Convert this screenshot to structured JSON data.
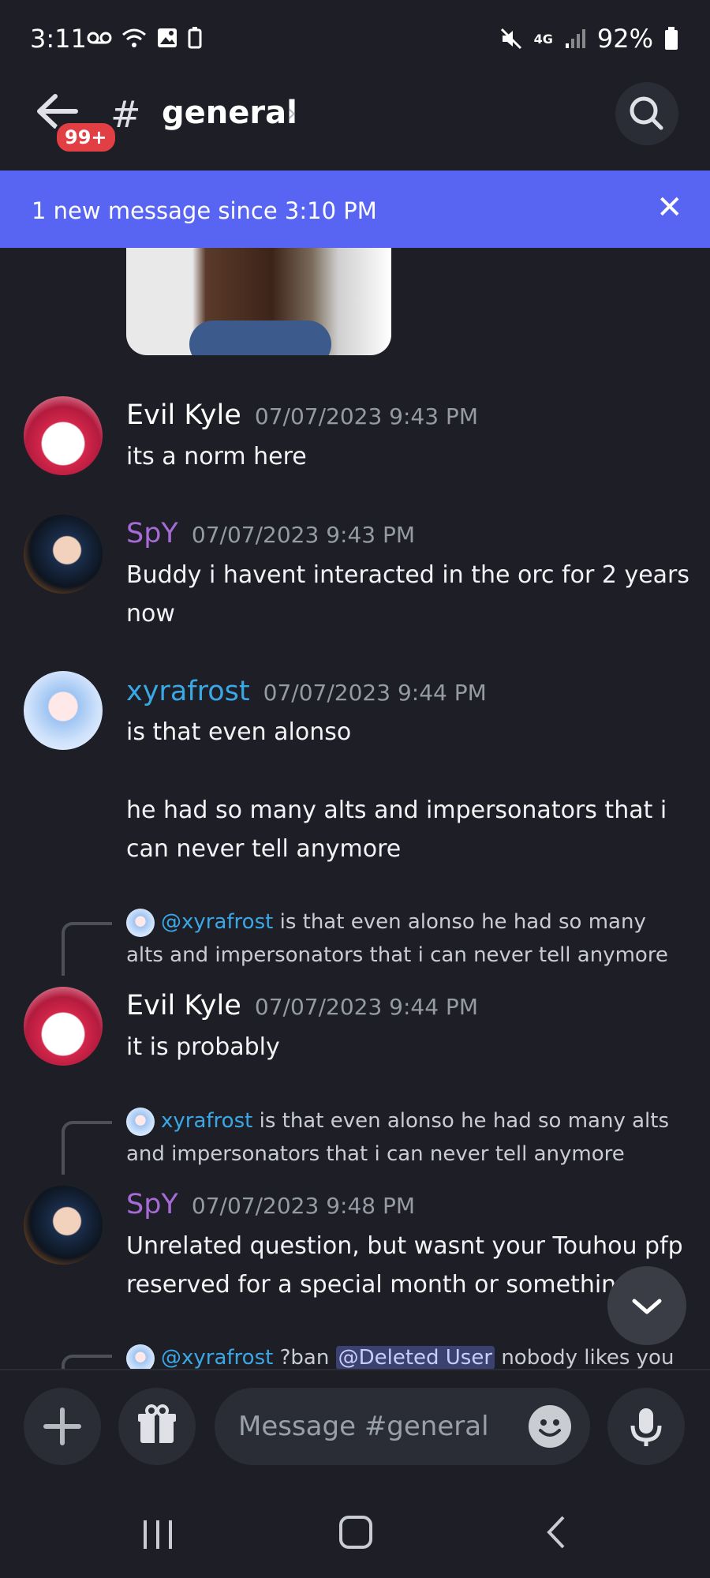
{
  "status_bar": {
    "time": "3:11",
    "battery": "92%",
    "icons": [
      "voicemail-icon",
      "wifi-icon",
      "image-icon",
      "battery-saver-icon",
      "mute-icon",
      "4g-lte-icon",
      "signal-icon",
      "battery-icon"
    ]
  },
  "header": {
    "back_icon": "arrow-left-icon",
    "badge": "99+",
    "hash": "#",
    "channel_name": "general",
    "chevron": "›",
    "search_icon": "search-icon"
  },
  "banner": {
    "text": "1 new message since 3:10 PM",
    "close": "✕"
  },
  "messages": [
    {
      "user": "Evil Kyle",
      "time": "07/07/2023 9:43 PM",
      "text": "its a norm here"
    },
    {
      "user": "SpY",
      "time": "07/07/2023 9:43 PM",
      "line1": "Buddy i havent interacted in the orc for 2 years",
      "line2": "now"
    },
    {
      "user": "xyrafrost",
      "time": "07/07/2023 9:44 PM",
      "text": "is that even alonso",
      "text2": "he had so many alts and impersonators that i",
      "text3": "can never tell anymore"
    },
    {
      "reply_name": "@xyrafrost",
      "reply_line1": "is that even alonso  he had so many",
      "reply_line2": "alts and impersonators that i can never tell anymore",
      "user": "Evil Kyle",
      "time": "07/07/2023 9:44 PM",
      "text": "it is probably"
    },
    {
      "reply_name": "xyrafrost",
      "reply_line1": "is that even alonso  he had so many alts",
      "reply_line2": "and impersonators that i can never tell anymore",
      "user": "SpY",
      "time": "07/07/2023 9:48 PM",
      "line1": "Unrelated question, but wasnt your Touhou pfp",
      "line2": "reserved for a special month or somethin"
    },
    {
      "reply_name": "@xyrafrost",
      "reply_cmd": "?ban",
      "reply_mention": "@Deleted User",
      "reply_tail": "nobody likes you"
    }
  ],
  "composer": {
    "placeholder": "Message #general",
    "plus_icon": "plus-icon",
    "gift_icon": "gift-icon",
    "emoji_icon": "emoji-icon",
    "mic_icon": "microphone-icon"
  },
  "colors": {
    "background": "#1e1f26",
    "banner": "#5865f2",
    "spy_name": "#a66bd6",
    "xyra_name": "#3ba8e6",
    "badge": "#e23f45"
  }
}
